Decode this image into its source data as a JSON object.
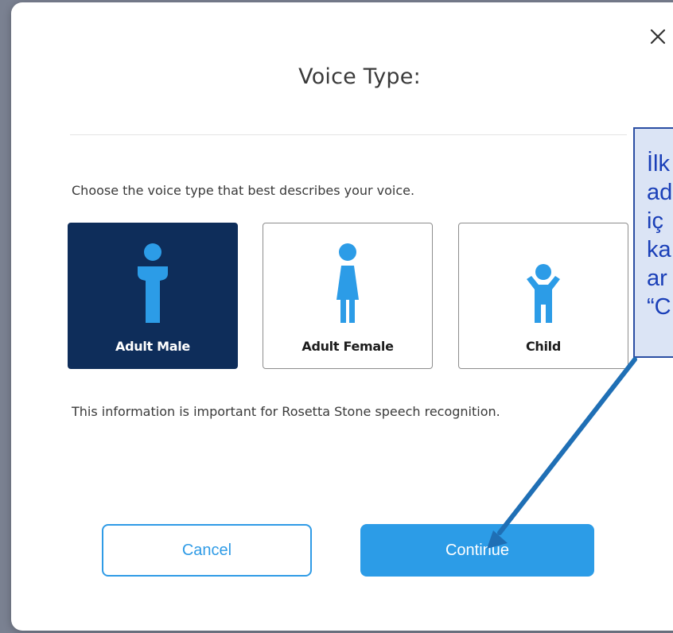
{
  "dialog": {
    "title": "Voice Type:",
    "close_icon": "close-icon",
    "instructions": "Choose the voice type that best describes your voice.",
    "voice_options": [
      {
        "label": "Adult Male",
        "icon": "adult-male-icon",
        "selected": true
      },
      {
        "label": "Adult Female",
        "icon": "adult-female-icon",
        "selected": false
      },
      {
        "label": "Child",
        "icon": "child-icon",
        "selected": false
      }
    ],
    "info": "This information is important for Rosetta Stone speech recognition.",
    "cancel_label": "Cancel",
    "continue_label": "Continue"
  },
  "callout": {
    "lines": [
      "İlk",
      "ad",
      "iç",
      "ka",
      "ar",
      "“C"
    ]
  },
  "colors": {
    "selected_bg": "#0e2d5a",
    "icon_blue": "#2c9ce7",
    "icon_white": "#ffffff",
    "primary_button": "#2c9ce7",
    "callout_bg": "#dbe4f5",
    "callout_text": "#1a3fb8",
    "arrow": "#1f6fb5"
  }
}
